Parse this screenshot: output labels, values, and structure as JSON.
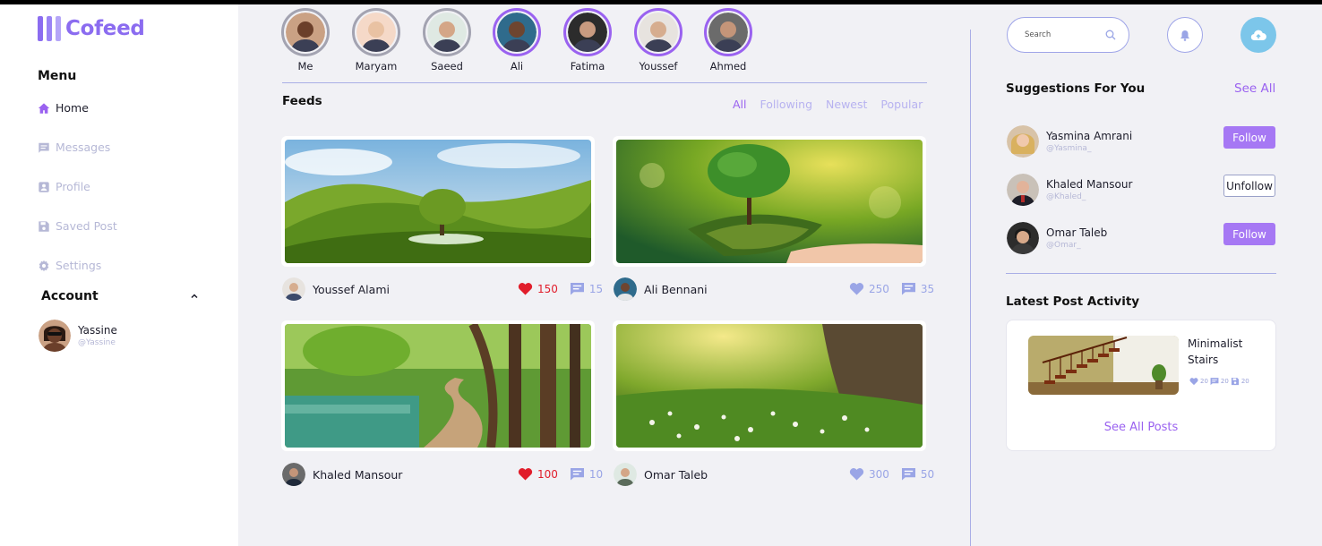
{
  "app": {
    "name": "Cofeed",
    "logo_colors": [
      "#8b6cf0",
      "#9a83f5",
      "#b5a6f8"
    ]
  },
  "sidebar": {
    "menu_title": "Menu",
    "items": [
      {
        "label": "Home",
        "icon": "home-icon",
        "active": true
      },
      {
        "label": "Messages",
        "icon": "message-icon",
        "active": false
      },
      {
        "label": "Profile",
        "icon": "profile-icon",
        "active": false
      },
      {
        "label": "Saved Post",
        "icon": "save-icon",
        "active": false
      },
      {
        "label": "Settings",
        "icon": "gear-icon",
        "active": false
      }
    ],
    "account_title": "Account",
    "user": {
      "name": "Yassine",
      "handle": "@Yassine"
    }
  },
  "stories": [
    {
      "name": "Me",
      "active": false,
      "skin": "#6b3f2a",
      "bg": "#caa184"
    },
    {
      "name": "Maryam",
      "active": false,
      "skin": "#e9c2a3",
      "bg": "#f5d9c8"
    },
    {
      "name": "Saeed",
      "active": false,
      "skin": "#d4a687",
      "bg": "#dfe9e3"
    },
    {
      "name": "Ali",
      "active": true,
      "skin": "#6e4530",
      "bg": "#2f6b8c"
    },
    {
      "name": "Fatima",
      "active": true,
      "skin": "#c99b80",
      "bg": "#2c2c2c"
    },
    {
      "name": "Youssef",
      "active": true,
      "skin": "#d6ad8f",
      "bg": "#e7e3df"
    },
    {
      "name": "Ahmed",
      "active": true,
      "skin": "#c49579",
      "bg": "#6b6b6b"
    }
  ],
  "feeds": {
    "title": "Feeds",
    "filters": [
      {
        "label": "All",
        "active": true
      },
      {
        "label": "Following",
        "active": false
      },
      {
        "label": "Newest",
        "active": false
      },
      {
        "label": "Popular",
        "active": false
      }
    ],
    "posts": [
      {
        "author": "Youssef Alami",
        "likes": "150",
        "comments": "15",
        "liked": true,
        "scene": "hills"
      },
      {
        "author": "Ali Bennani",
        "likes": "250",
        "comments": "35",
        "liked": false,
        "scene": "tree-hand"
      },
      {
        "author": "Khaled Mansour",
        "likes": "100",
        "comments": "10",
        "liked": true,
        "scene": "forest-path"
      },
      {
        "author": "Omar Taleb",
        "likes": "300",
        "comments": "50",
        "liked": false,
        "scene": "meadow"
      }
    ]
  },
  "search": {
    "placeholder": "Search"
  },
  "suggestions": {
    "title": "Suggestions For You",
    "see_all": "See All",
    "people": [
      {
        "name": "Yasmina Amrani",
        "handle": "@Yasmina_",
        "action": "Follow"
      },
      {
        "name": "Khaled Mansour",
        "handle": "@Khaled_",
        "action": "Unfollow"
      },
      {
        "name": "Omar Taleb",
        "handle": "@Omar_",
        "action": "Follow"
      }
    ]
  },
  "latest": {
    "title": "Latest Post Activity",
    "post_name": "Minimalist Stairs",
    "likes": "20",
    "comments": "20",
    "saves": "20",
    "see_all_posts": "See All Posts"
  },
  "colors": {
    "accent": "#9a62f0",
    "heart_red": "#e11d2b",
    "muted_blue": "#9aa5e6",
    "upload": "#7cc6ea"
  }
}
